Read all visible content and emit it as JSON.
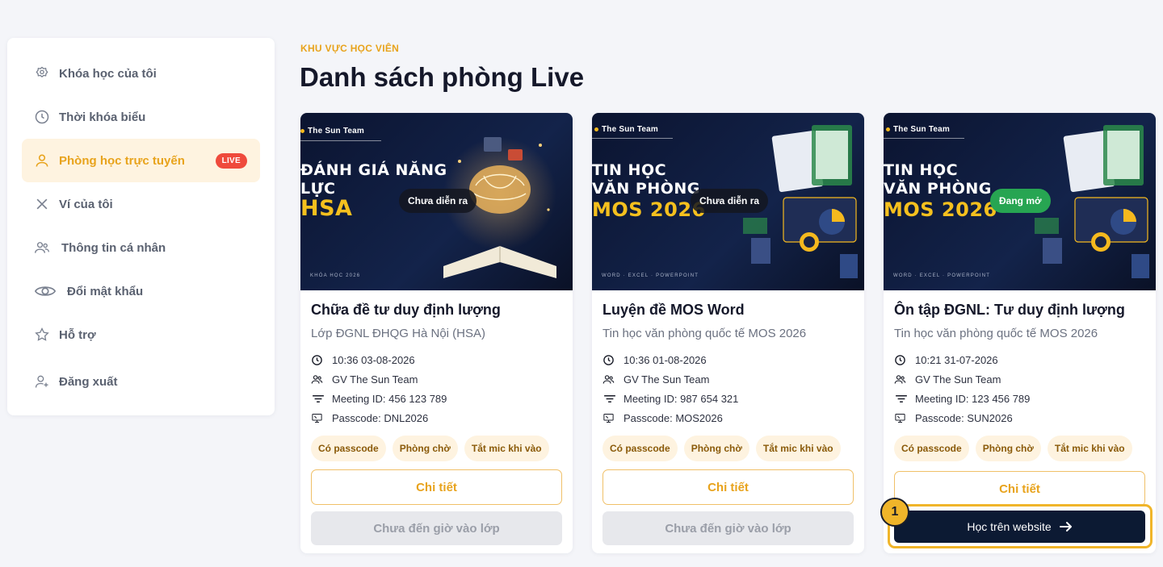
{
  "sidebar": {
    "items": [
      {
        "label": "Khóa học của tôi",
        "icon": "medal-icon"
      },
      {
        "label": "Thời khóa biểu",
        "icon": "clock-icon"
      },
      {
        "label": "Phòng học trực tuyến",
        "icon": "user-icon",
        "badge": "LIVE"
      },
      {
        "label": "Ví của tôi",
        "icon": "close-icon"
      },
      {
        "label": "Thông tin cá nhân",
        "icon": "users-icon"
      },
      {
        "label": "Đổi mật khẩu",
        "icon": "eye-icon"
      },
      {
        "label": "Hỗ trợ",
        "icon": "star-icon"
      },
      {
        "label": "Đăng xuất",
        "icon": "user-plus-icon"
      }
    ]
  },
  "header": {
    "eyebrow": "KHU VỰC HỌC VIÊN",
    "title": "Danh sách phòng Live"
  },
  "cards": [
    {
      "banner": {
        "brand": "The Sun Team",
        "line1": "ĐÁNH GIÁ NĂNG",
        "line2": "LỰC",
        "highlight": "HSA",
        "footer": "KHÓA HỌC 2026"
      },
      "status": "Chưa diễn ra",
      "title": "Chữa đề tư duy định lượng",
      "subtitle": "Lớp ĐGNL ĐHQG Hà Nội (HSA)",
      "time": "10:36 03-08-2026",
      "teacher": "GV The Sun Team",
      "meeting": "Meeting ID: 456 123 789",
      "passcode": "Passcode: DNL2026",
      "tags": [
        "Có passcode",
        "Phòng chờ",
        "Tắt mic khi vào"
      ],
      "detail_label": "Chi tiết",
      "join_label": "Chưa đến giờ vào lớp"
    },
    {
      "banner": {
        "brand": "The Sun Team",
        "line1": "TIN HỌC",
        "line2": "VĂN PHÒNG",
        "highlight": "MOS 2026",
        "footer": "WORD · EXCEL · POWERPOINT"
      },
      "status": "Chưa diễn ra",
      "title": "Luyện đề MOS Word",
      "subtitle": "Tin học văn phòng quốc tế MOS 2026",
      "time": "10:36 01-08-2026",
      "teacher": "GV The Sun Team",
      "meeting": "Meeting ID: 987 654 321",
      "passcode": "Passcode: MOS2026",
      "tags": [
        "Có passcode",
        "Phòng chờ",
        "Tắt mic khi vào"
      ],
      "detail_label": "Chi tiết",
      "join_label": "Chưa đến giờ vào lớp"
    },
    {
      "banner": {
        "brand": "The Sun Team",
        "line1": "TIN HỌC",
        "line2": "VĂN PHÒNG",
        "highlight": "MOS 2026",
        "footer": "WORD · EXCEL · POWERPOINT"
      },
      "status": "Đang mở",
      "title": "Ôn tập ĐGNL: Tư duy định lượng",
      "subtitle": "Tin học văn phòng quốc tế MOS 2026",
      "time": "10:21 31-07-2026",
      "teacher": "GV The Sun Team",
      "meeting": "Meeting ID: 123 456 789",
      "passcode": "Passcode: SUN2026",
      "tags": [
        "Có passcode",
        "Phòng chờ",
        "Tắt mic khi vào"
      ],
      "detail_label": "Chi tiết",
      "join_label": "Học trên website"
    }
  ],
  "step_marker": "1",
  "colors": {
    "accent": "#e8a31c",
    "live": "#ef4a3c",
    "open": "#27a552",
    "navy": "#0c1a33"
  }
}
